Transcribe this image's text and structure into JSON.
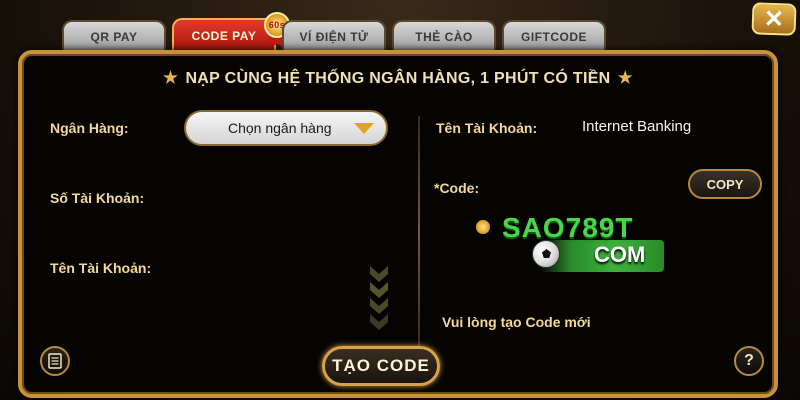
{
  "tabs": [
    {
      "label": "QR PAY",
      "active": false
    },
    {
      "label": "CODE PAY",
      "active": true,
      "badge": "60s"
    },
    {
      "label": "VÍ ĐIỆN TỬ",
      "active": false
    },
    {
      "label": "THẺ CÀO",
      "active": false
    },
    {
      "label": "GIFTCODE",
      "active": false
    }
  ],
  "header": {
    "title": "NẠP CÙNG HỆ THỐNG NGÂN HÀNG, 1 PHÚT CÓ TIỀN",
    "star": "✭"
  },
  "left": {
    "bank_label": "Ngân Hàng:",
    "bank_select": "Chọn ngân hàng",
    "account_number_label": "Số Tài Khoản:",
    "account_name_label": "Tên Tài Khoản:"
  },
  "right": {
    "account_name_label": "Tên Tài Khoản:",
    "account_name_value": "Internet Banking",
    "code_label": "*Code:",
    "copy_label": "COPY",
    "note": "Vui lòng tạo Code mới"
  },
  "watermark": {
    "brand": "SAO789T",
    "suffix": "COM"
  },
  "create_button": "TẠO CODE",
  "icons": {
    "close": "✕",
    "help": "?",
    "history": "document-icon"
  },
  "colors": {
    "accent": "#c9923a",
    "active_tab": "#c21a0e",
    "label": "#f3d89a"
  }
}
